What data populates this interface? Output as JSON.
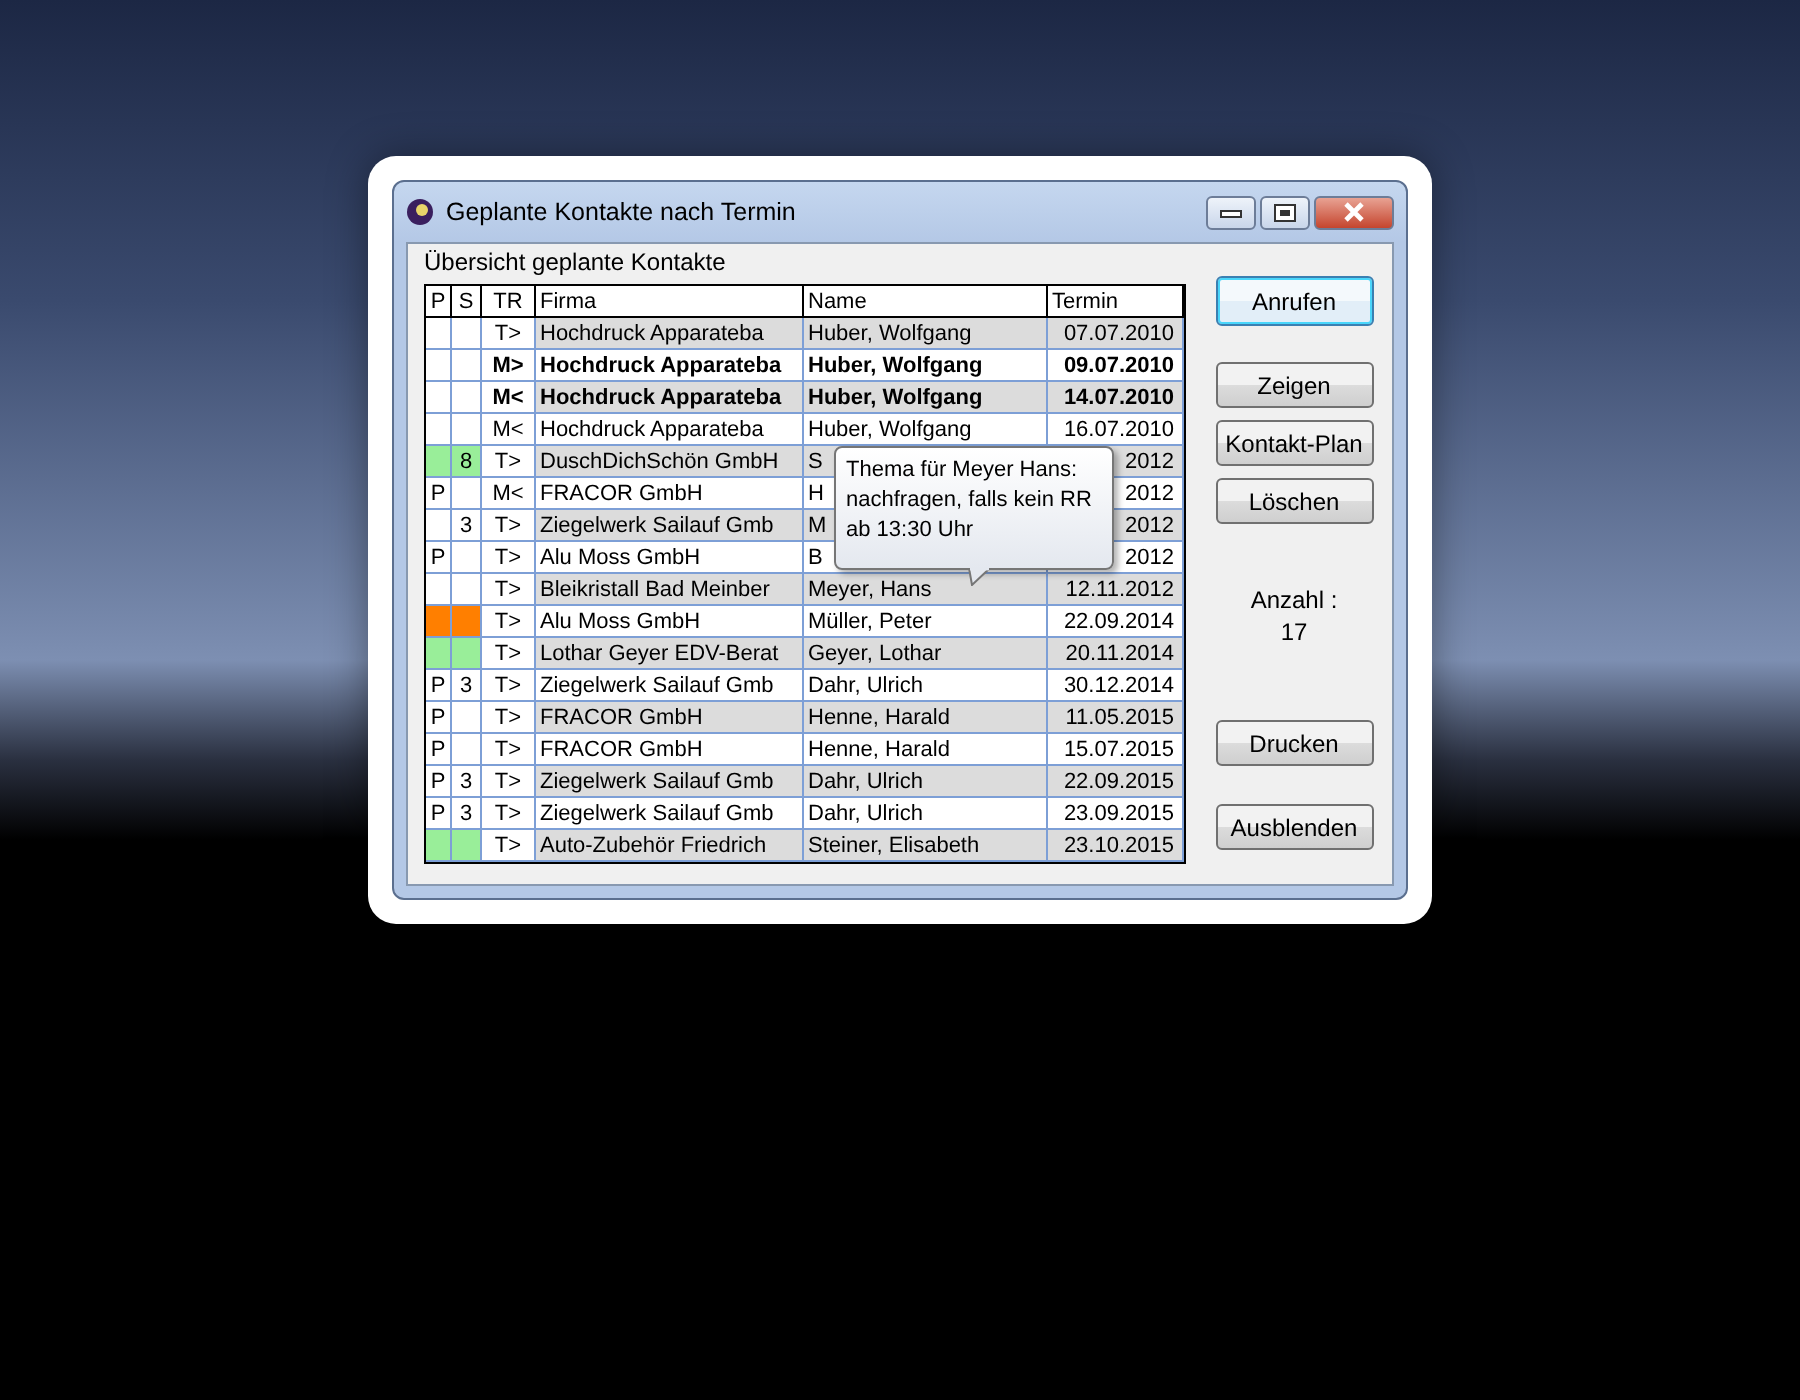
{
  "window": {
    "title": "Geplante Kontakte nach Termin"
  },
  "group": {
    "label": "Übersicht geplante Kontakte"
  },
  "table": {
    "columns": [
      "P",
      "S",
      "TR",
      "Firma",
      "Name",
      "Termin"
    ],
    "rows": [
      {
        "p": "",
        "s": "",
        "tr": "T>",
        "firma": "Hochdruck Apparateba",
        "name": "Huber, Wolfgang",
        "termin": "07.07.2010",
        "bold": false
      },
      {
        "p": "",
        "s": "",
        "tr": "M>",
        "firma": "Hochdruck Apparateba",
        "name": "Huber, Wolfgang",
        "termin": "09.07.2010",
        "bold": true
      },
      {
        "p": "",
        "s": "",
        "tr": "M<",
        "firma": "Hochdruck Apparateba",
        "name": "Huber, Wolfgang",
        "termin": "14.07.2010",
        "bold": true
      },
      {
        "p": "",
        "s": "",
        "tr": "M<",
        "firma": "Hochdruck Apparateba",
        "name": "Huber, Wolfgang",
        "termin": "16.07.2010",
        "bold": false
      },
      {
        "p": "",
        "s": "8",
        "tr": "T>",
        "firma": "DuschDichSchön GmbH",
        "name": "S",
        "termin": "2012",
        "bold": false,
        "color": "#99ee99"
      },
      {
        "p": "P",
        "s": "",
        "tr": "M<",
        "firma": "FRACOR GmbH",
        "name": "H",
        "termin": "2012",
        "bold": false
      },
      {
        "p": "",
        "s": "3",
        "tr": "T>",
        "firma": "Ziegelwerk Sailauf Gmb",
        "name": "M",
        "termin": "2012",
        "bold": false
      },
      {
        "p": "P",
        "s": "",
        "tr": "T>",
        "firma": "Alu Moss GmbH",
        "name": "B",
        "termin": "2012",
        "bold": false
      },
      {
        "p": "",
        "s": "",
        "tr": "T>",
        "firma": "Bleikristall Bad Meinber",
        "name": "Meyer, Hans",
        "termin": "12.11.2012",
        "bold": false
      },
      {
        "p": "",
        "s": "",
        "tr": "T>",
        "firma": "Alu Moss GmbH",
        "name": "Müller, Peter",
        "termin": "22.09.2014",
        "bold": false,
        "color": "#ff7f00"
      },
      {
        "p": "",
        "s": "",
        "tr": "T>",
        "firma": "Lothar Geyer EDV-Berat",
        "name": "Geyer, Lothar",
        "termin": "20.11.2014",
        "bold": false,
        "color": "#99ee99"
      },
      {
        "p": "P",
        "s": "3",
        "tr": "T>",
        "firma": "Ziegelwerk Sailauf Gmb",
        "name": "Dahr, Ulrich",
        "termin": "30.12.2014",
        "bold": false
      },
      {
        "p": "P",
        "s": "",
        "tr": "T>",
        "firma": "FRACOR GmbH",
        "name": "Henne, Harald",
        "termin": "11.05.2015",
        "bold": false
      },
      {
        "p": "P",
        "s": "",
        "tr": "T>",
        "firma": "FRACOR GmbH",
        "name": "Henne, Harald",
        "termin": "15.07.2015",
        "bold": false
      },
      {
        "p": "P",
        "s": "3",
        "tr": "T>",
        "firma": "Ziegelwerk Sailauf Gmb",
        "name": "Dahr, Ulrich",
        "termin": "22.09.2015",
        "bold": false
      },
      {
        "p": "P",
        "s": "3",
        "tr": "T>",
        "firma": "Ziegelwerk Sailauf Gmb",
        "name": "Dahr, Ulrich",
        "termin": "23.09.2015",
        "bold": false
      },
      {
        "p": "",
        "s": "",
        "tr": "T>",
        "firma": "Auto-Zubehör Friedrich",
        "name": "Steiner, Elisabeth",
        "termin": "23.10.2015",
        "bold": false,
        "color": "#99ee99"
      }
    ]
  },
  "tooltip": {
    "lines": [
      "Thema für Meyer Hans:",
      "nachfragen, falls kein RR",
      "ab 13:30 Uhr"
    ]
  },
  "buttons": [
    {
      "label": "Anrufen",
      "default": true
    },
    {
      "label": "Zeigen",
      "default": false
    },
    {
      "label": "Kontakt-Plan",
      "default": false
    },
    {
      "label": "Löschen",
      "default": false
    }
  ],
  "count": {
    "label": "Anzahl :",
    "value": "17"
  },
  "bottom_buttons": [
    {
      "label": "Drucken",
      "default": false
    },
    {
      "label": "Ausblenden",
      "default": false
    }
  ]
}
